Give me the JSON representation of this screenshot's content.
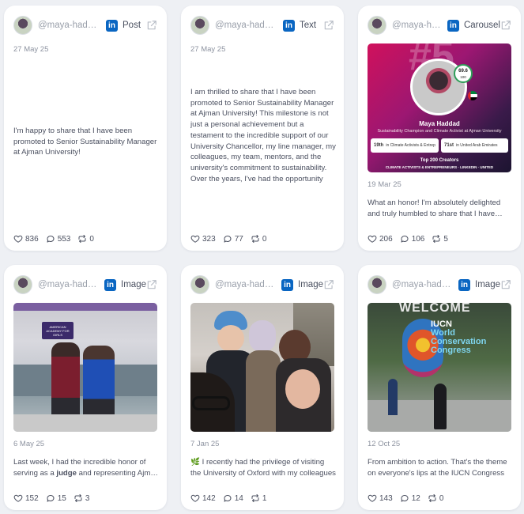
{
  "cards": [
    {
      "handle": "@maya-haddad",
      "type": "Post",
      "date": "27 May 25",
      "text": "I'm happy to share that I have been promoted to Senior Sustainability Manager at Ajman University!",
      "likes": "836",
      "comments": "553",
      "reposts": "0"
    },
    {
      "handle": "@maya-haddad",
      "type": "Text",
      "date": "27 May 25",
      "text": "I am thrilled to share that I have been promoted to Senior Sustainability Manager at Ajman University! This milestone is not just a personal achievement but a testament to the incredible support of our University Chancellor, my line manager, my colleagues, my team, mentors, and the university's commitment to sustainability. Over the years, I've had the opportunity",
      "likes": "323",
      "comments": "77",
      "reposts": "0"
    },
    {
      "handle": "@maya-haddad",
      "type": "Carousel",
      "date": "19 Mar 25",
      "text": "What an honor! I'm absolutely delighted and truly humbled to share that I have been",
      "likes": "206",
      "comments": "106",
      "reposts": "5",
      "carousel": {
        "big_number": "#5",
        "score": "69.6",
        "score_sub": "100",
        "name": "Maya Haddad",
        "subtitle": "Sustainability Champion and Climate Activist at Ajman University",
        "rank1": "19th",
        "rank1_label": "in Climate Activists & Entrepreneurs",
        "rank2": "71st",
        "rank2_label": "in United Arab Emirates",
        "footer1": "Top 200 Creators",
        "footer2": "CLIMATE ACTIVISTS & ENTREPRENEURS · LINKEDIN · UNITED"
      }
    },
    {
      "handle": "@maya-haddad",
      "type": "Image",
      "date": "6 May 25",
      "text_pre": "Last week, I had the incredible honor of serving as a ",
      "text_bold": "judge",
      "text_post": " and representing Ajman University at the",
      "likes": "152",
      "comments": "15",
      "reposts": "3",
      "image": {
        "banner": "AMERICAN ACADEMY FOR GIRLS"
      }
    },
    {
      "handle": "@maya-haddad",
      "type": "Image",
      "date": "7 Jan 25",
      "text": "🌿 I recently had the privilege of visiting the University of Oxford with my colleagues",
      "likes": "142",
      "comments": "14",
      "reposts": "1"
    },
    {
      "handle": "@maya-haddad",
      "type": "Image",
      "date": "12 Oct 25",
      "text": "From ambition to action. That's the theme on everyone's lips at the IUCN Congress",
      "likes": "143",
      "comments": "12",
      "reposts": "0",
      "image": {
        "welcome": "WELCOME",
        "line1": "IUCN",
        "line2": "World",
        "line3": "Conservation",
        "line4": "Congress"
      }
    }
  ],
  "icons": {
    "linkedin": "in",
    "like": "heart-icon",
    "comment": "comment-icon",
    "repost": "repost-icon",
    "external": "external-link-icon"
  },
  "colors": {
    "linkedin": "#0a66c2",
    "background": "#eef0f4",
    "card": "#ffffff"
  }
}
